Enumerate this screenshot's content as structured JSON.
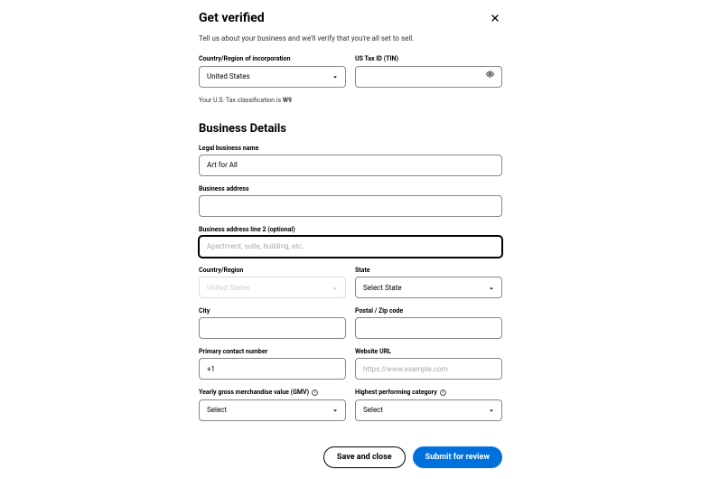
{
  "header": {
    "title": "Get verified",
    "subtitle": "Tell us about your business and we'll verify that you're all set to sell."
  },
  "verify": {
    "country_label": "Country/Region of incorporation",
    "country_value": "United States",
    "tax_label": "US Tax ID (TIN)",
    "tax_value": "",
    "helper_prefix": "Your U.S. Tax classification is ",
    "helper_bold": "W9"
  },
  "details": {
    "section_title": "Business Details",
    "legal_name_label": "Legal business name",
    "legal_name_value": "Art for All",
    "address_label": "Business address",
    "address_value": "",
    "address2_label": "Business address line 2 (optional)",
    "address2_placeholder": "Apartment, suite, building, etc.",
    "address2_value": "",
    "country_label": "Country/Region",
    "country_value": "United States",
    "state_label": "State",
    "state_value": "Select State",
    "city_label": "City",
    "city_value": "",
    "postal_label": "Postal / Zip code",
    "postal_value": "",
    "phone_label": "Primary contact number",
    "phone_value": "+1",
    "url_label": "Website URL",
    "url_placeholder": "https://www.example.com",
    "url_value": "",
    "gmv_label": "Yearly gross merchandise value (GMV)",
    "gmv_value": "Select",
    "category_label": "Highest performing category",
    "category_value": "Select"
  },
  "footer": {
    "save_label": "Save and close",
    "submit_label": "Submit for review"
  }
}
